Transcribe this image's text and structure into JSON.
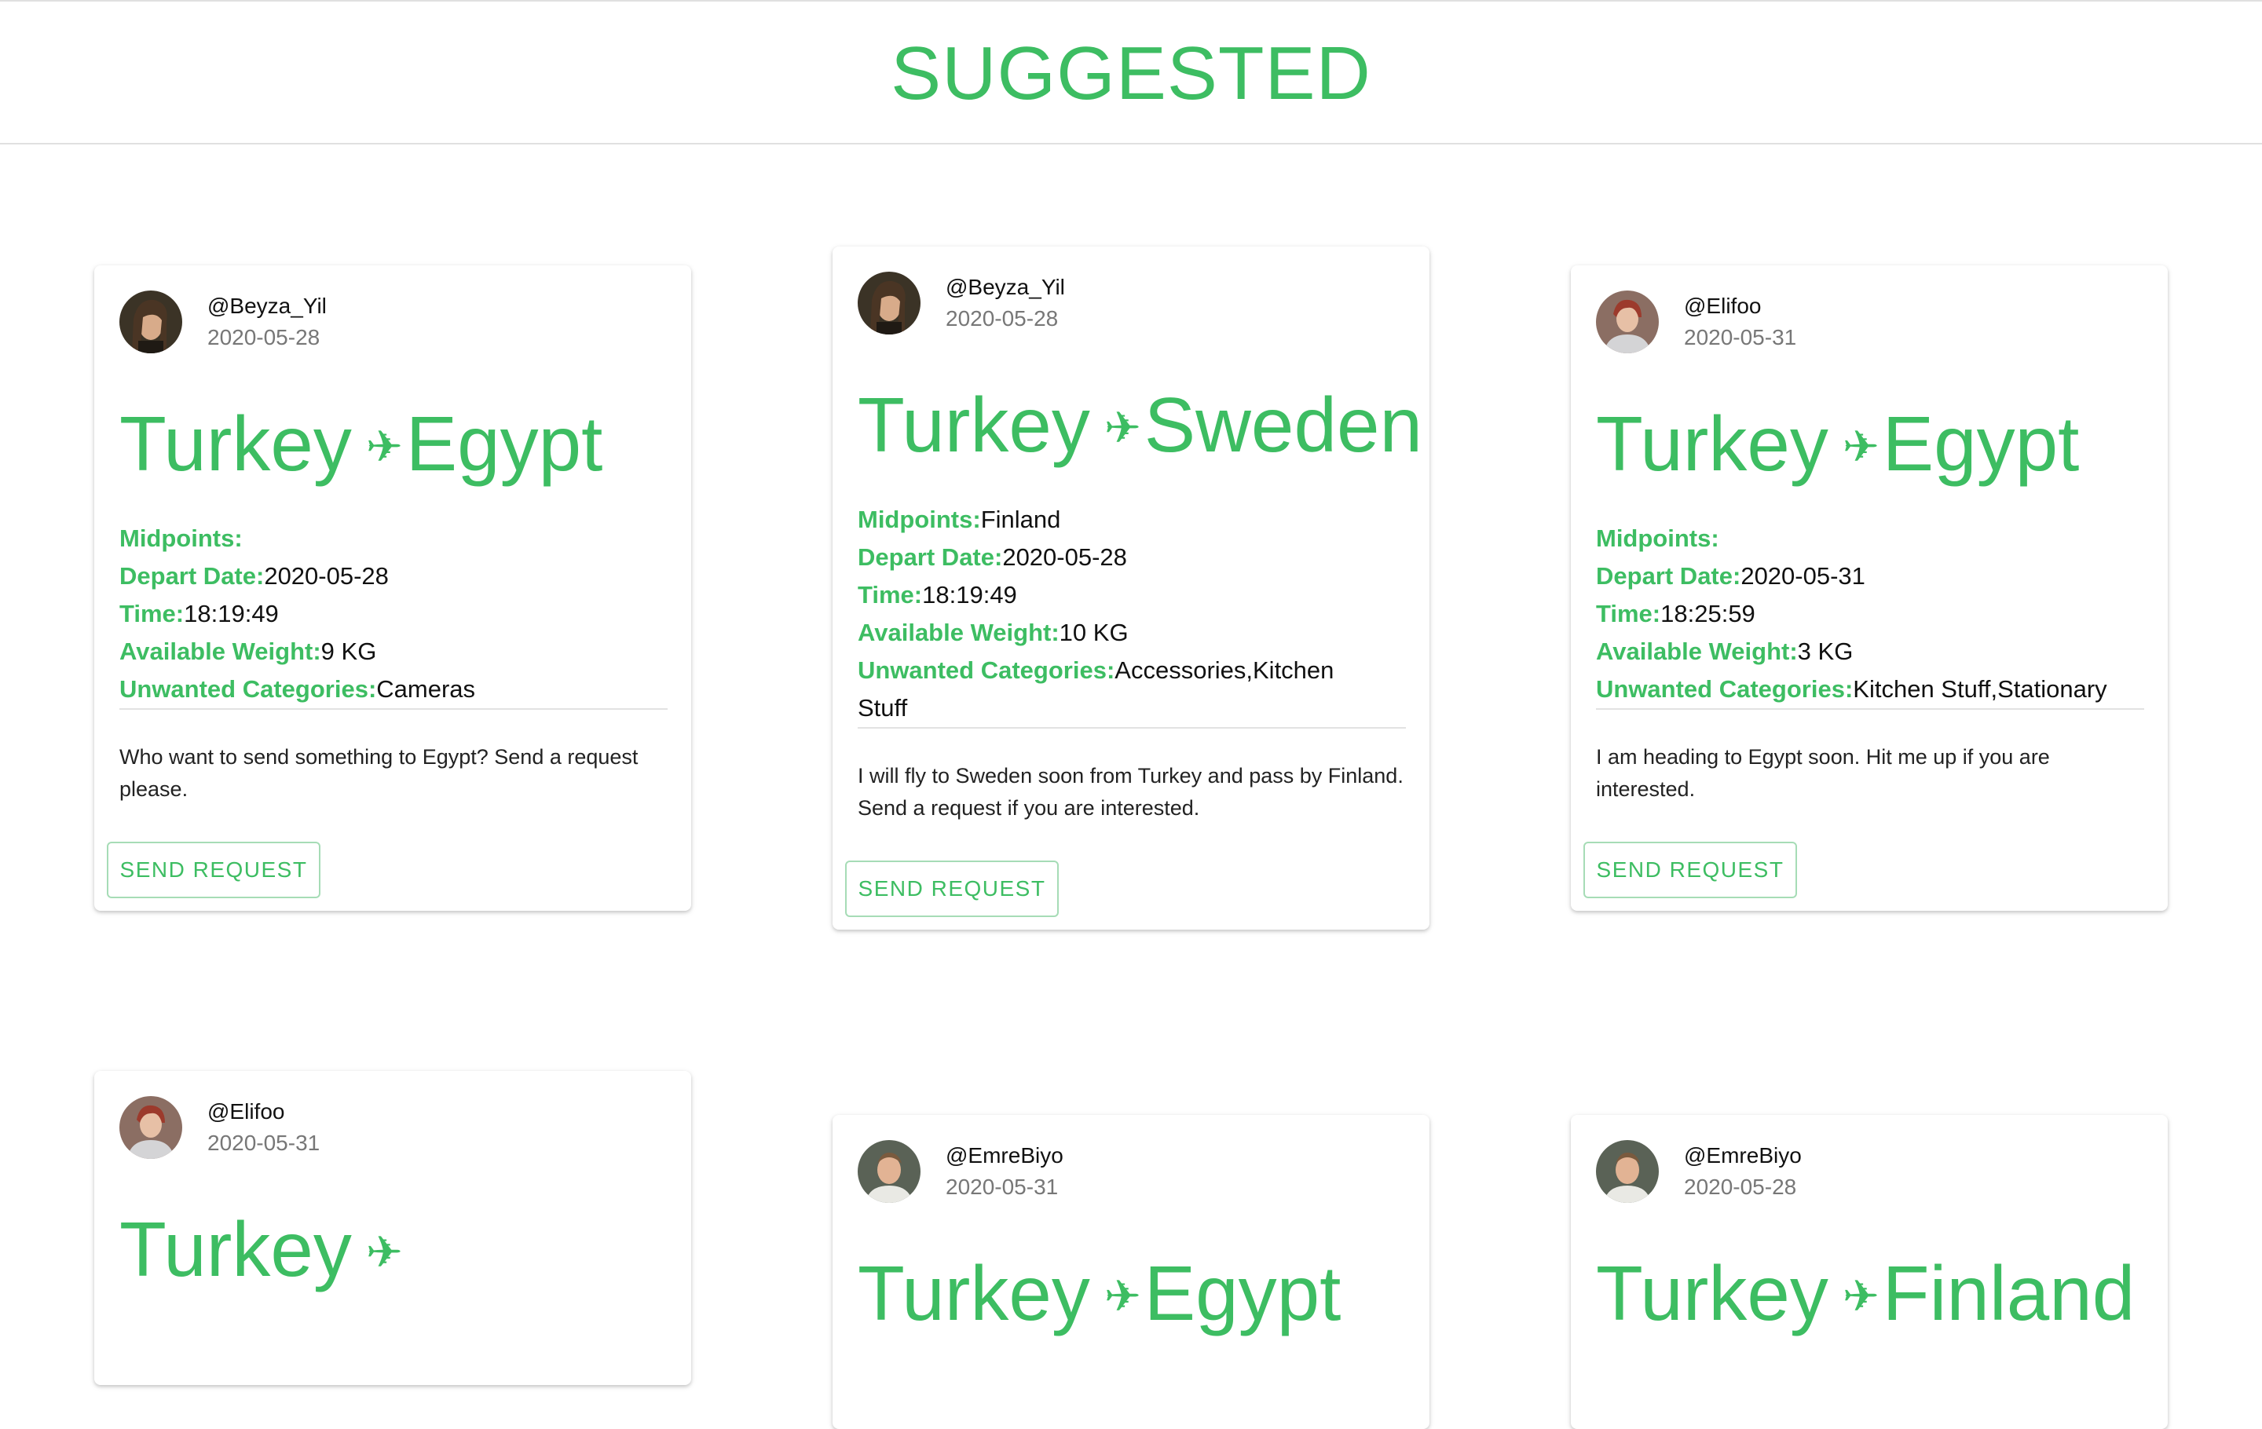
{
  "header": {
    "title": "SUGGESTED"
  },
  "labels": {
    "midpoints": "Midpoints:",
    "depart_date": "Depart Date:",
    "time": "Time:",
    "available_weight": "Available Weight:",
    "unwanted_categories": "Unwanted Categories:",
    "send_request": "SEND REQUEST",
    "plane_icon": "✈"
  },
  "colors": {
    "accent": "#3dbd62"
  },
  "cards": [
    {
      "username": "@Beyza_Yil",
      "date": "2020-05-28",
      "from": "Turkey",
      "to": "Egypt",
      "midpoints": "",
      "depart_date": "2020-05-28",
      "time": "18:19:49",
      "available_weight": "9 KG",
      "unwanted_categories": "Cameras",
      "description": "Who want to send something to Egypt? Send a request please."
    },
    {
      "username": "@Beyza_Yil",
      "date": "2020-05-28",
      "from": "Turkey",
      "to": "Sweden",
      "midpoints": "Finland",
      "depart_date": "2020-05-28",
      "time": "18:19:49",
      "available_weight": "10 KG",
      "unwanted_categories": "Accessories,Kitchen Stuff",
      "description": "I will fly to Sweden soon from Turkey and pass by Finland. Send a request if you are interested."
    },
    {
      "username": "@Elifoo",
      "date": "2020-05-31",
      "from": "Turkey",
      "to": "Egypt",
      "midpoints": "",
      "depart_date": "2020-05-31",
      "time": "18:25:59",
      "available_weight": "3 KG",
      "unwanted_categories": "Kitchen Stuff,Stationary",
      "description": "I am heading to Egypt soon. Hit me up if you are interested."
    },
    {
      "username": "@Elifoo",
      "date": "2020-05-31",
      "from": "Turkey",
      "to": ""
    },
    {
      "username": "@EmreBiyo",
      "date": "2020-05-31",
      "from": "Turkey",
      "to": "Egypt"
    },
    {
      "username": "@EmreBiyo",
      "date": "2020-05-28",
      "from": "Turkey",
      "to": "Finland"
    }
  ]
}
